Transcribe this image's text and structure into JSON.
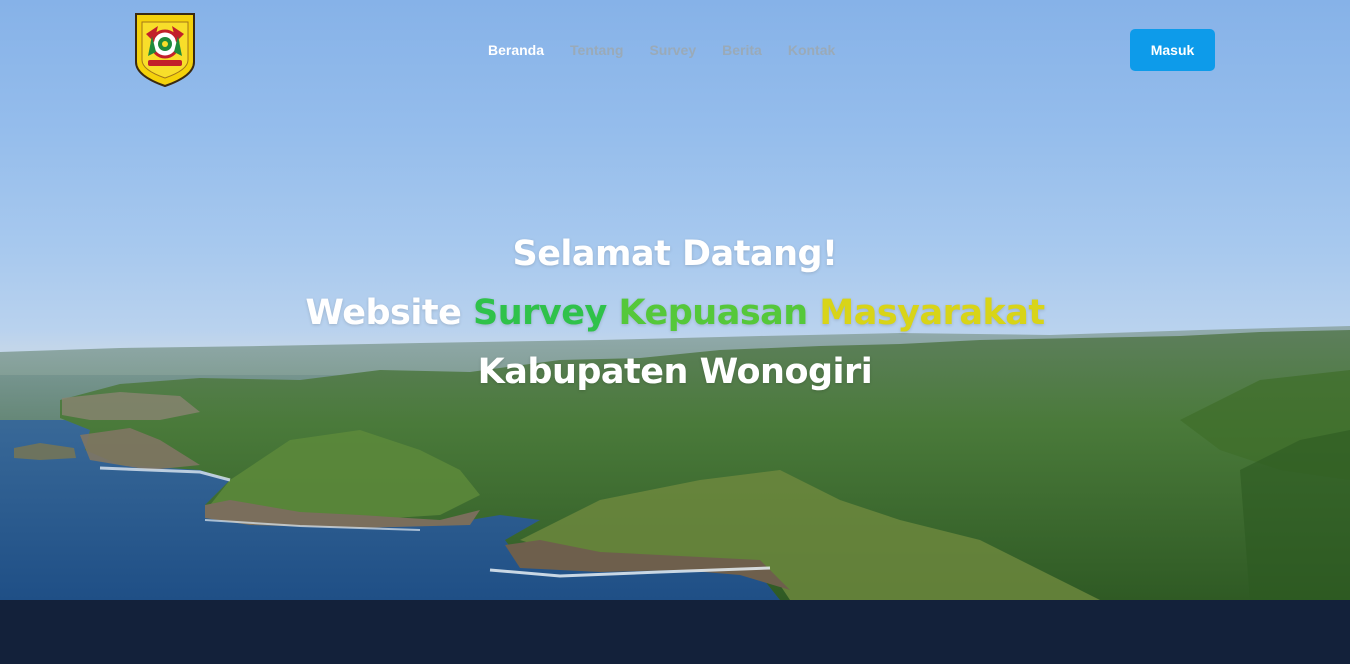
{
  "nav": {
    "logo_icon": "kabupaten-wonogiri-crest-icon",
    "items": [
      {
        "label": "Beranda",
        "active": true
      },
      {
        "label": "Tentang",
        "active": false
      },
      {
        "label": "Survey",
        "active": false
      },
      {
        "label": "Berita",
        "active": false
      },
      {
        "label": "Kontak",
        "active": false
      }
    ],
    "login_label": "Masuk"
  },
  "hero": {
    "welcome": "Selamat Datang!",
    "line2_prefix": "Website",
    "line2_survey": "Survey",
    "line2_kepuasan": "Kepuasan",
    "line2_masyarakat": "Masyarakat",
    "line3": "Kabupaten Wonogiri"
  },
  "colors": {
    "accent_button": "#0d9bea",
    "survey": "#2fc24a",
    "kepuasan": "#55c83a",
    "masyarakat": "#d8d418",
    "footer": "#13213a"
  }
}
